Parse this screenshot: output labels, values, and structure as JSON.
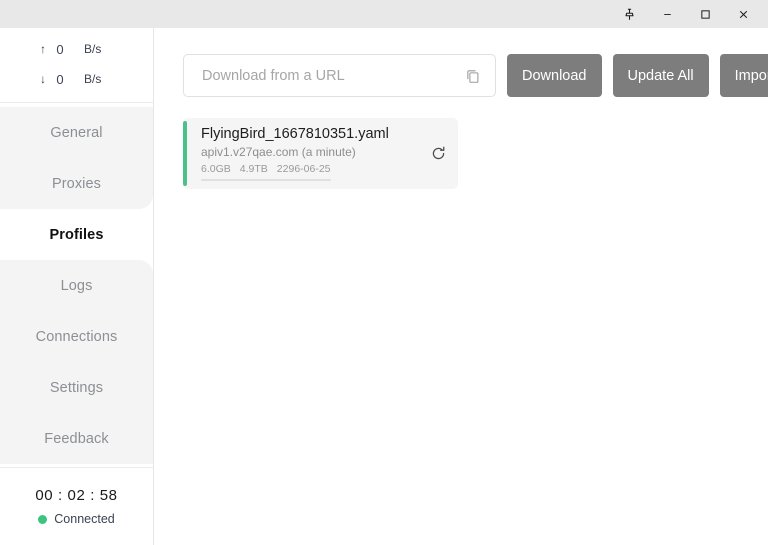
{
  "titlebar": {
    "buttons": [
      {
        "name": "pin",
        "label": "Pin"
      },
      {
        "name": "minimize",
        "label": "Minimize"
      },
      {
        "name": "maximize",
        "label": "Maximize"
      },
      {
        "name": "close",
        "label": "Close"
      }
    ]
  },
  "sidebar": {
    "speeds": [
      {
        "arrow": "↑",
        "value": "0",
        "unit": "B/s"
      },
      {
        "arrow": "↓",
        "value": "0",
        "unit": "B/s"
      }
    ],
    "items": [
      {
        "label": "General",
        "active": false
      },
      {
        "label": "Proxies",
        "active": false
      },
      {
        "label": "Profiles",
        "active": true
      },
      {
        "label": "Logs",
        "active": false
      },
      {
        "label": "Connections",
        "active": false
      },
      {
        "label": "Settings",
        "active": false
      },
      {
        "label": "Feedback",
        "active": false
      }
    ],
    "footer": {
      "timer": "00 : 02 : 58",
      "status": "Connected",
      "status_color": "#3bc47f"
    }
  },
  "toolbar": {
    "url_placeholder": "Download from a URL",
    "url_value": "",
    "paste_icon": "copy-icon",
    "download_label": "Download",
    "update_all_label": "Update All",
    "import_label": "Import"
  },
  "profiles": [
    {
      "title": "FlyingBird_1667810351.yaml",
      "source": "apiv1.v27qae.com (a minute)",
      "used": "6.0GB",
      "total": "4.9TB",
      "expires": "2296-06-25",
      "accent_color": "#4cc28a",
      "refresh_icon": "refresh-icon"
    }
  ]
}
